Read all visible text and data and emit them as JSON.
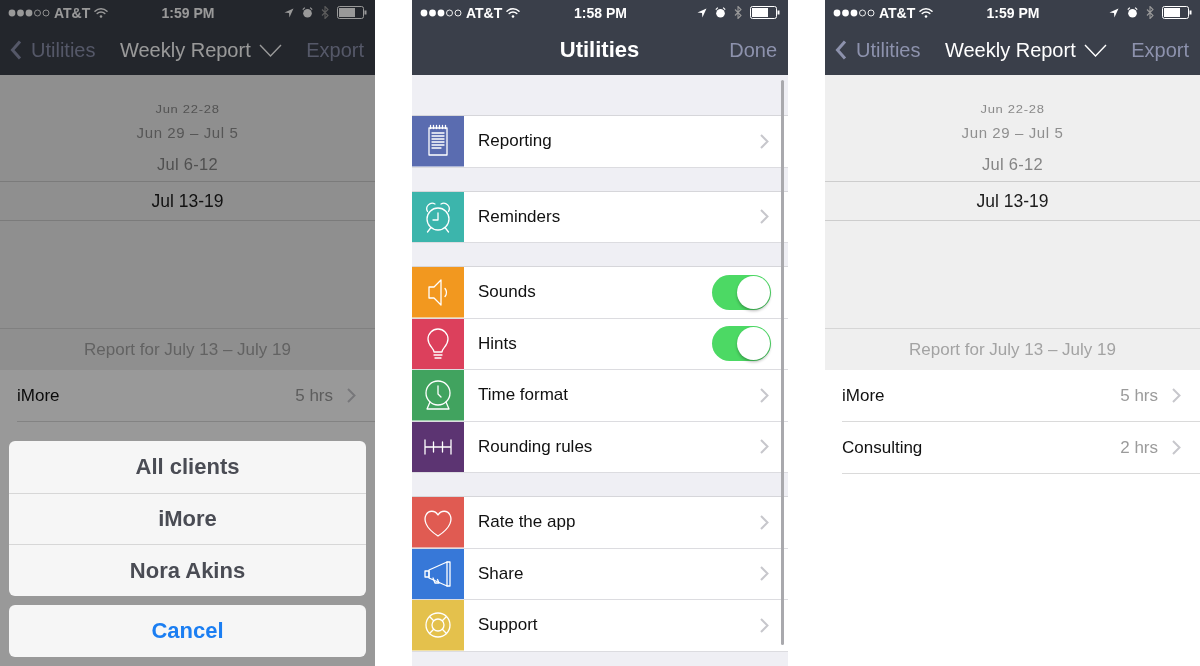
{
  "screens": [
    {
      "kind": "weekly_report",
      "dimmed": true,
      "status_bar": {
        "carrier": "AT&T",
        "time": "1:59 PM"
      },
      "nav_bar": {
        "back": "Utilities",
        "title": "Weekly Report",
        "action": "Export"
      },
      "week_picker": [
        {
          "label": "Jun 22-28",
          "selected": false
        },
        {
          "label": "Jun 29 – Jul 5",
          "selected": false
        },
        {
          "label": "Jul 6-12",
          "selected": false
        },
        {
          "label": "Jul 13-19",
          "selected": true
        }
      ],
      "report_header": "Report for July 13 – July 19",
      "clients": [
        {
          "name": "iMore",
          "hours": "5 hrs"
        }
      ],
      "action_sheet": {
        "options": [
          "All clients",
          "iMore",
          "Nora Akins"
        ],
        "cancel": "Cancel"
      }
    },
    {
      "kind": "utilities",
      "dimmed": false,
      "status_bar": {
        "carrier": "AT&T",
        "time": "1:58 PM"
      },
      "nav_bar": {
        "title": "Utilities",
        "action": "Done"
      },
      "sections": [
        {
          "rows": [
            {
              "label": "Reporting",
              "kind": "link",
              "color": "#5a6cb0"
            }
          ]
        },
        {
          "rows": [
            {
              "label": "Reminders",
              "kind": "link",
              "color": "#3cb5ac"
            }
          ]
        },
        {
          "rows": [
            {
              "label": "Sounds",
              "kind": "toggle",
              "on": true,
              "color": "#f2981f"
            },
            {
              "label": "Hints",
              "kind": "toggle",
              "on": true,
              "color": "#dc405c"
            },
            {
              "label": "Time format",
              "kind": "link",
              "color": "#41a35f"
            },
            {
              "label": "Rounding rules",
              "kind": "link",
              "color": "#5c3472"
            }
          ]
        },
        {
          "rows": [
            {
              "label": "Rate the app",
              "kind": "link",
              "color": "#e05b52"
            },
            {
              "label": "Share",
              "kind": "link",
              "color": "#3778d8"
            },
            {
              "label": "Support",
              "kind": "link",
              "color": "#e4c14c"
            }
          ]
        }
      ]
    },
    {
      "kind": "weekly_report",
      "dimmed": false,
      "status_bar": {
        "carrier": "AT&T",
        "time": "1:59 PM"
      },
      "nav_bar": {
        "back": "Utilities",
        "title": "Weekly Report",
        "action": "Export"
      },
      "week_picker": [
        {
          "label": "Jun 22-28",
          "selected": false
        },
        {
          "label": "Jun 29 – Jul 5",
          "selected": false
        },
        {
          "label": "Jul 6-12",
          "selected": false
        },
        {
          "label": "Jul 13-19",
          "selected": true
        }
      ],
      "report_header": "Report for July 13 – July 19",
      "clients": [
        {
          "name": "iMore",
          "hours": "5 hrs"
        },
        {
          "name": "Consulting",
          "hours": "2 hrs"
        }
      ]
    }
  ]
}
